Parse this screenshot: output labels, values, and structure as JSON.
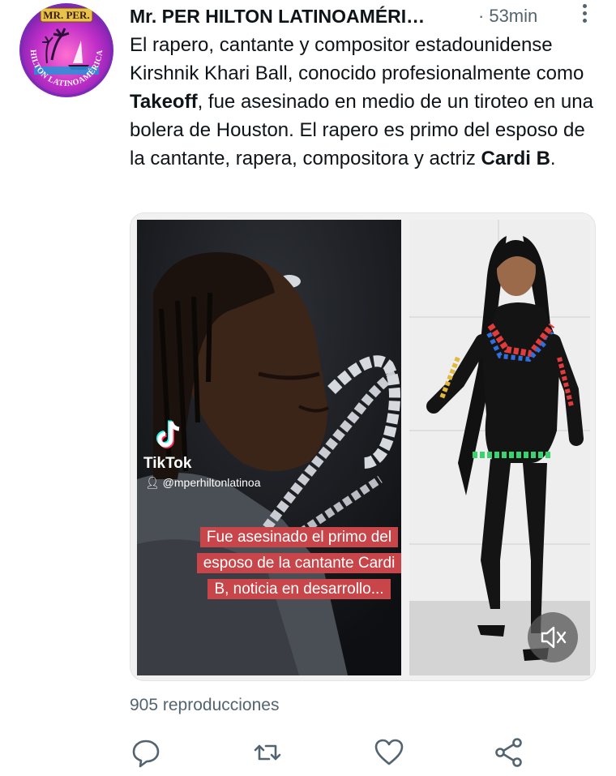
{
  "account": {
    "name": "Mr. PER HILTON LATINOAMÉRI…",
    "time": "53min",
    "separator": "·",
    "avatar_top_text": "MR. PER.",
    "avatar_ring_text": "HILTON LATINOAMÉRICA"
  },
  "tweet": {
    "segments": [
      "El rapero, cantante y compositor estadounidense Kirshnik Khari Ball, conocido profesionalmente como ",
      "Takeoff",
      ", fue asesinado en medio de un tiroteo en una bolera de Houston. El rapero es primo del esposo de la cantante, rapera, compositora y actriz ",
      "Cardi B",
      "."
    ]
  },
  "media": {
    "tiktok_label": "TikTok",
    "tiktok_user": "@mperhiltonlatinoa",
    "caption": "Fue asesinado el primo del esposo de la cantante Cardi B, noticia en desarrollo...",
    "mute_icon": "speaker-muted-icon"
  },
  "stats": {
    "views": "905 reproducciones"
  },
  "actions": [
    {
      "name": "reply",
      "icon": "speech-bubble-icon"
    },
    {
      "name": "retweet",
      "icon": "retweet-arrows-icon"
    },
    {
      "name": "like",
      "icon": "heart-icon"
    },
    {
      "name": "share",
      "icon": "share-nodes-icon"
    }
  ],
  "colors": {
    "secondary_text": "#536471",
    "caption_bg": "#c8454a",
    "primary_text": "#0f1419"
  }
}
